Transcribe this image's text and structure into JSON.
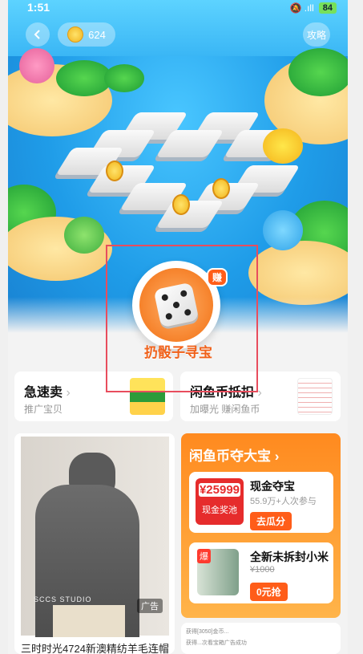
{
  "status_bar": {
    "time": "1:51",
    "icons": "🔕 .ıll ",
    "battery": "84"
  },
  "game": {
    "coin_count": "624",
    "guide_label": "攻略",
    "back_icon": "chevron-left-icon",
    "earn_badge": "赚",
    "dice_label": "扔骰子寻宝"
  },
  "promos": [
    {
      "title": "急速卖",
      "subtitle": "推广宝贝"
    },
    {
      "title": "闲鱼币抵扣",
      "subtitle": "加曝光 赚闲鱼币"
    }
  ],
  "feed": {
    "left": {
      "ad_label": "广告",
      "brand": "SCCS STUDIO",
      "caption": "三时时光4724新澳精纺羊毛连帽"
    },
    "right": {
      "title": "闲鱼币夺大宝",
      "prize1": {
        "price": "¥25999",
        "pool_label": "现金奖池",
        "name": "现金夺宝",
        "meta": "55.9万+人次参与",
        "button": "去瓜分"
      },
      "prize2": {
        "hot": "爆",
        "name": "全新未拆封小米",
        "old_price": "¥1000",
        "button": "0元抢"
      }
    },
    "right_bottom": {
      "line1": "获得[3050]金币...",
      "line2": "获得...次看宝箱广告成功"
    }
  },
  "colors": {
    "accent": "#ff5d19",
    "highlight_box": "#e84d5d",
    "sea": "#1f9ce8"
  }
}
